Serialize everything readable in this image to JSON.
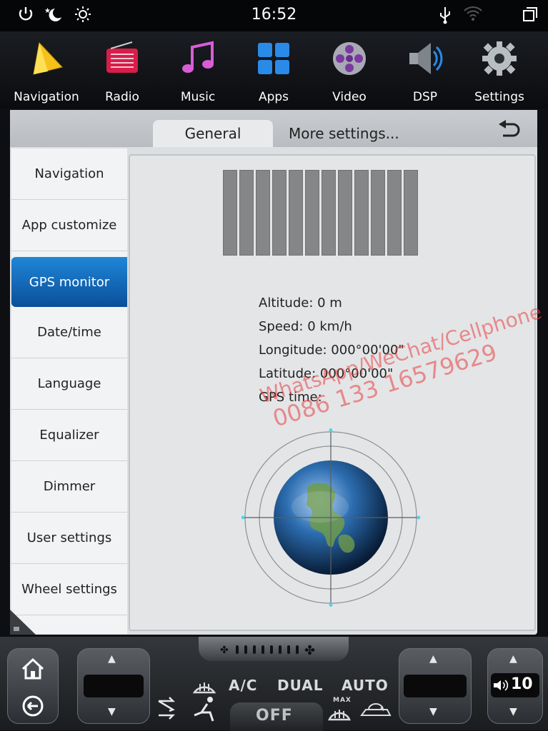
{
  "status": {
    "time": "16:52",
    "icons": [
      "power-icon",
      "night-mode-icon",
      "brightness-icon",
      "usb-icon",
      "wifi-icon",
      "window-switch-icon"
    ]
  },
  "apps": [
    {
      "label": "Navigation",
      "icon": "navigation-icon"
    },
    {
      "label": "Radio",
      "icon": "radio-icon"
    },
    {
      "label": "Music",
      "icon": "music-icon"
    },
    {
      "label": "Apps",
      "icon": "apps-icon"
    },
    {
      "label": "Video",
      "icon": "video-icon"
    },
    {
      "label": "DSP",
      "icon": "speaker-icon"
    },
    {
      "label": "Settings",
      "icon": "gear-icon"
    }
  ],
  "tabs": {
    "general": "General",
    "more": "More settings..."
  },
  "sidebar": [
    "Navigation",
    "App customize",
    "GPS monitor",
    "Date/time",
    "Language",
    "Equalizer",
    "Dimmer",
    "User settings",
    "Wheel settings"
  ],
  "sidebar_active_index": 2,
  "gps": {
    "altitude": "Altitude:  0 m",
    "speed": "Speed:  0 km/h",
    "longitude": "Longitude:  000°00'00\"",
    "latitude": "Latitude:  000°00'00\"",
    "gps_time": "GPS time:"
  },
  "watermark": {
    "line1": "WhatsApp/WeChat/Cellphone",
    "line2": "0086 133 16579629"
  },
  "climate": {
    "ac": "A/C",
    "dual": "DUAL",
    "auto": "AUTO",
    "off": "OFF",
    "max": "MAX",
    "volume": "10"
  },
  "colors": {
    "accent": "#1a7fd4",
    "panel": "#dcdfe2"
  }
}
